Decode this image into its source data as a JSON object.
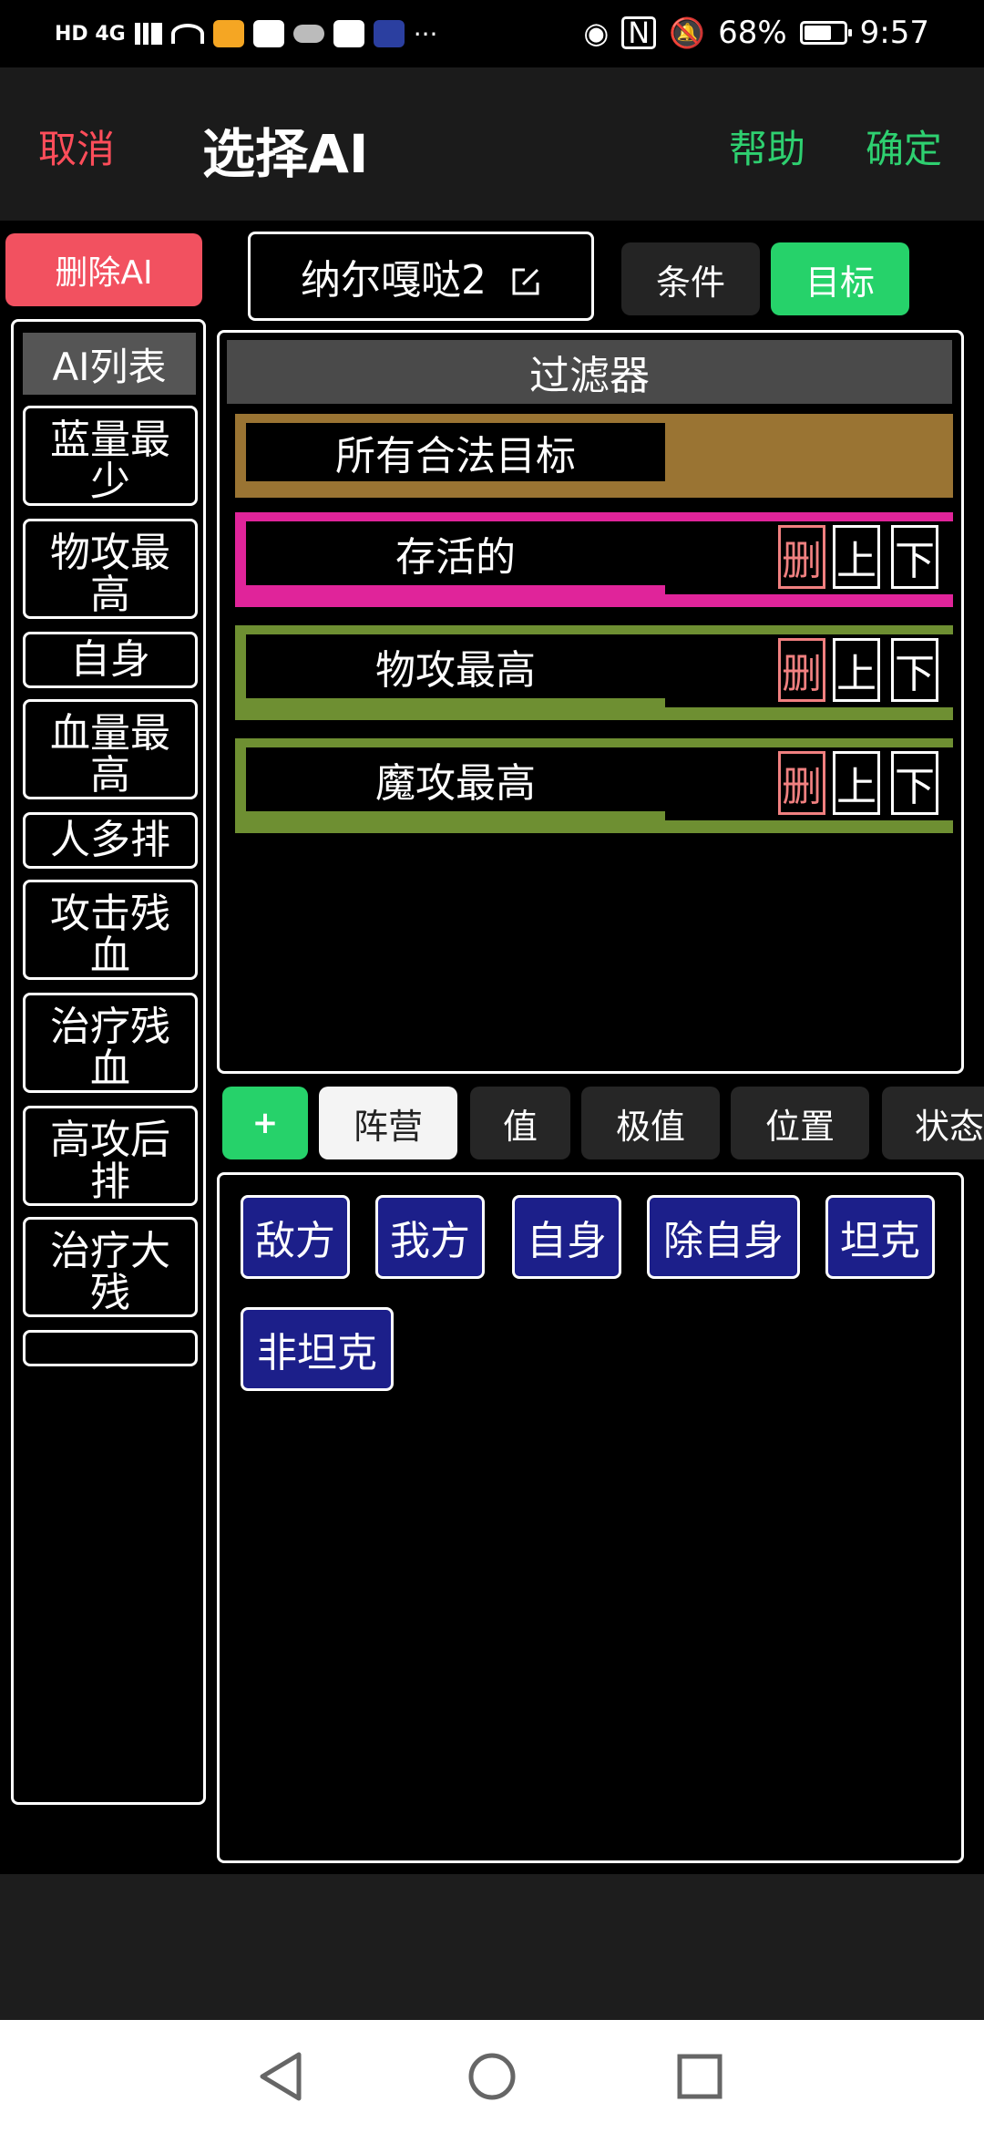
{
  "status_bar": {
    "network": "HD 4G",
    "battery_percent": "68%",
    "time": "9:57",
    "more": "···",
    "battery_level": 0.68
  },
  "header": {
    "cancel_label": "取消",
    "title": "选择AI",
    "help_label": "帮助",
    "ok_label": "确定"
  },
  "delete_ai_label": "删除AI",
  "ai_list": {
    "header": "AI列表",
    "items": [
      "蓝量最少",
      "物攻最高",
      "自身",
      "血量最高",
      "人多排",
      "攻击残血",
      "治疗残血",
      "高攻后排",
      "治疗大残"
    ]
  },
  "name_field": {
    "value": "纳尔嘎哒2"
  },
  "tabs": {
    "condition": "条件",
    "target": "目标"
  },
  "filter": {
    "header": "过滤器",
    "rows": [
      {
        "label": "所有合法目标",
        "color": "#9a7433"
      },
      {
        "label": "存活的",
        "color": "#e0249a"
      },
      {
        "label": "物攻最高",
        "color": "#6e8f32"
      },
      {
        "label": "魔攻最高",
        "color": "#6e8f32"
      }
    ],
    "delete_label": "删",
    "up_label": "上",
    "down_label": "下"
  },
  "categories": {
    "add_label": "+",
    "items": [
      "阵营",
      "值",
      "极值",
      "位置",
      "状态"
    ]
  },
  "options": {
    "items": [
      "敌方",
      "我方",
      "自身",
      "除自身",
      "坦克",
      "非坦克"
    ]
  },
  "colors": {
    "accent_green": "#26d26a",
    "danger_red": "#f25160",
    "chip_blue": "#1c1f8a"
  }
}
